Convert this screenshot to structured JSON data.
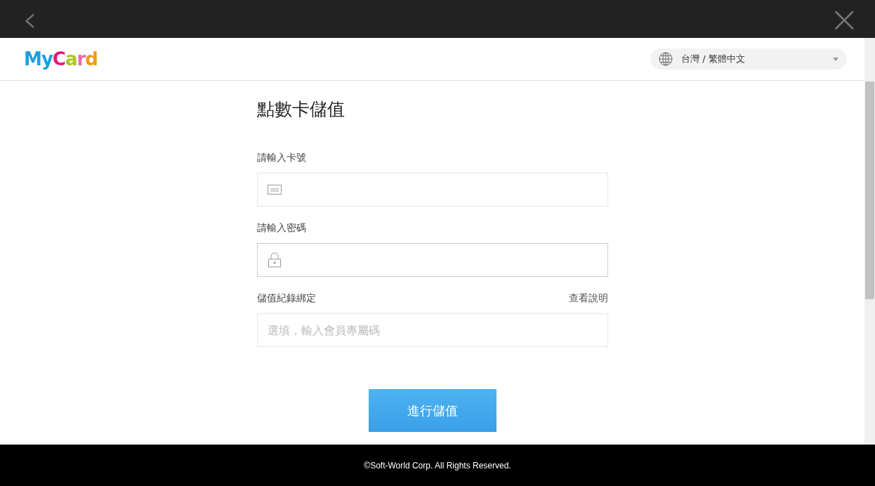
{
  "top_bar": {
    "back": "‹",
    "close": "×"
  },
  "header": {
    "logo": "MyCard",
    "language": "台灣 / 繁體中文"
  },
  "title": "點數卡儲值",
  "fields": [
    {
      "label": "請輸入卡號",
      "kind": "card",
      "focused": false
    },
    {
      "label": "請輸入密碼",
      "kind": "password",
      "focused": true
    },
    {
      "label": "儲值紀錄綁定",
      "kind": "text",
      "focused": false,
      "link": "查看說明",
      "placeholder": "選填，輸入會員專屬碼"
    }
  ],
  "submit": "進行儲值",
  "footer": "©Soft-World Corp. All Rights Reserved."
}
